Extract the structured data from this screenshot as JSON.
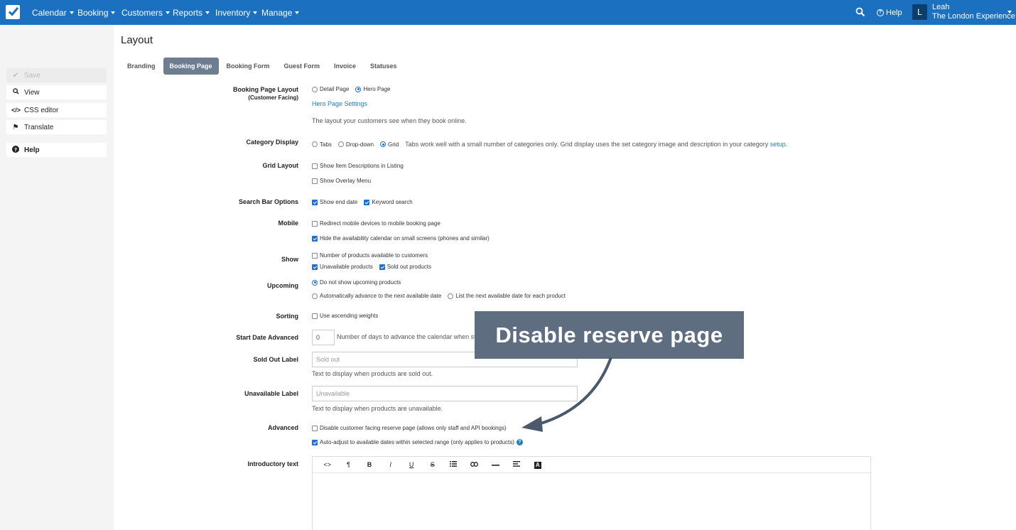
{
  "topnav": {
    "items": [
      "Calendar",
      "Booking",
      "Customers",
      "Reports",
      "Inventory",
      "Manage"
    ],
    "help_label": "Help",
    "avatar_initial": "L",
    "user_name": "Leah",
    "company": "The London Experience"
  },
  "sidebar": {
    "save_label": "Save",
    "view_label": "View",
    "css_editor_label": "CSS editor",
    "translate_label": "Translate",
    "help_label": "Help"
  },
  "page": {
    "title": "Layout",
    "tabs": [
      "Branding",
      "Booking Page",
      "Booking Form",
      "Guest Form",
      "Invoice",
      "Statuses"
    ],
    "active_tab": "Booking Page"
  },
  "form": {
    "booking_page_layout": {
      "label": "Booking Page Layout",
      "sublabel": "(Customer Facing)",
      "options": [
        "Detail Page",
        "Hero Page"
      ],
      "selected": "Hero Page",
      "settings_link": "Hero Page Settings",
      "help": "The layout your customers see when they book online."
    },
    "category_display": {
      "label": "Category Display",
      "options": [
        "Tabs",
        "Drop-down",
        "Grid"
      ],
      "selected": "Grid",
      "note": "Tabs work well with a small number of categories only. Grid display uses the set category image and description in your category",
      "note_link": "setup",
      "note_end": "."
    },
    "grid_layout": {
      "label": "Grid Layout",
      "show_item_descriptions": "Show Item Descriptions in Listing",
      "show_overlay_menu": "Show Overlay Menu"
    },
    "search_bar_options": {
      "label": "Search Bar Options",
      "show_end_date": "Show end date",
      "keyword_search": "Keyword search"
    },
    "mobile": {
      "label": "Mobile",
      "redirect": "Redirect mobile devices to mobile booking page",
      "hide_calendar": "Hide the availability calendar on small screens (phones and similar)"
    },
    "show": {
      "label": "Show",
      "number_available": "Number of products available to customers",
      "unavailable_products": "Unavailable products",
      "sold_out_products": "Sold out products"
    },
    "upcoming": {
      "label": "Upcoming",
      "do_not_show": "Do not show upcoming products",
      "auto_advance": "Automatically advance to the next available date",
      "list_next": "List the next available date for each product"
    },
    "sorting": {
      "label": "Sorting",
      "ascending": "Use ascending weights"
    },
    "start_date_advanced": {
      "label": "Start Date Advanced",
      "value": "0",
      "help": "Number of days to advance the calendar when start"
    },
    "sold_out_label": {
      "label": "Sold Out Label",
      "placeholder": "Sold out",
      "help": "Text to display when products are sold out."
    },
    "unavailable_label": {
      "label": "Unavailable Label",
      "placeholder": "Unavailable",
      "help": "Text to display when products are unavailable."
    },
    "advanced": {
      "label": "Advanced",
      "disable_reserve": "Disable customer facing reserve page (allows only staff and API bookings)",
      "auto_adjust": "Auto-adjust to available dates within selected range (only applies to products)"
    },
    "introductory_text": {
      "label": "Introductory text",
      "toolbar": [
        "<>",
        "¶",
        "B",
        "I",
        "U",
        "S",
        "list",
        "link",
        "rule",
        "align",
        "A"
      ]
    }
  },
  "callout": {
    "text": "Disable reserve page",
    "bg_color": "#5e6e80"
  },
  "colors": {
    "topbar": "#1b70c0",
    "accent": "#1e7bc8",
    "active_tab": "#6e7e90"
  }
}
